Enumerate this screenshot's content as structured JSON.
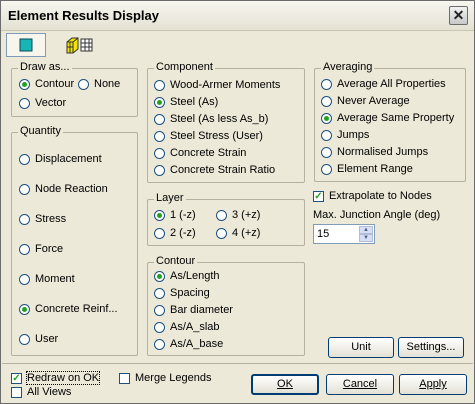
{
  "window": {
    "title": "Element Results Display"
  },
  "icons": {
    "close": "close-icon",
    "tab1": "element-2d-icon",
    "tab2": "element-3d-icon"
  },
  "drawAs": {
    "label": "Draw as...",
    "options": [
      {
        "label": "Contour",
        "checked": true
      },
      {
        "label": "None",
        "checked": false
      },
      {
        "label": "Vector",
        "checked": false
      }
    ]
  },
  "quantity": {
    "label": "Quantity",
    "options": [
      {
        "label": "Displacement",
        "checked": false
      },
      {
        "label": "Node Reaction",
        "checked": false
      },
      {
        "label": "Stress",
        "checked": false
      },
      {
        "label": "Force",
        "checked": false
      },
      {
        "label": "Moment",
        "checked": false
      },
      {
        "label": "Concrete Reinf...",
        "checked": true
      },
      {
        "label": "User",
        "checked": false
      }
    ]
  },
  "component": {
    "label": "Component",
    "options": [
      {
        "label": "Wood-Armer Moments",
        "checked": false
      },
      {
        "label": "Steel (As)",
        "checked": true
      },
      {
        "label": "Steel (As less As_b)",
        "checked": false
      },
      {
        "label": "Steel Stress (User)",
        "checked": false
      },
      {
        "label": "Concrete Strain",
        "checked": false
      },
      {
        "label": "Concrete Strain Ratio",
        "checked": false
      }
    ]
  },
  "layer": {
    "label": "Layer",
    "options": [
      {
        "label": "1 (-z)",
        "checked": true
      },
      {
        "label": "3 (+z)",
        "checked": false
      },
      {
        "label": "2 (-z)",
        "checked": false
      },
      {
        "label": "4 (+z)",
        "checked": false
      }
    ]
  },
  "contour": {
    "label": "Contour",
    "options": [
      {
        "label": "As/Length",
        "checked": true
      },
      {
        "label": "Spacing",
        "checked": false
      },
      {
        "label": "Bar diameter",
        "checked": false
      },
      {
        "label": "As/A_slab",
        "checked": false
      },
      {
        "label": "As/A_base",
        "checked": false
      }
    ]
  },
  "averaging": {
    "label": "Averaging",
    "options": [
      {
        "label": "Average All Properties",
        "checked": false
      },
      {
        "label": "Never Average",
        "checked": false
      },
      {
        "label": "Average Same Property",
        "checked": true
      },
      {
        "label": "Jumps",
        "checked": false
      },
      {
        "label": "Normalised Jumps",
        "checked": false
      },
      {
        "label": "Element Range",
        "checked": false
      }
    ]
  },
  "extrapolate": {
    "label": "Extrapolate to Nodes",
    "checked": true
  },
  "junction": {
    "label": "Max. Junction Angle (deg)",
    "value": "15"
  },
  "buttons": {
    "unit": "Unit",
    "settings": "Settings...",
    "ok": "OK",
    "cancel": "Cancel",
    "apply": "Apply"
  },
  "footer": {
    "redraw": {
      "label": "Redraw on OK",
      "checked": true
    },
    "allViews": {
      "label": "All Views",
      "checked": false
    },
    "mergeLegends": {
      "label": "Merge Legends",
      "checked": false
    }
  }
}
